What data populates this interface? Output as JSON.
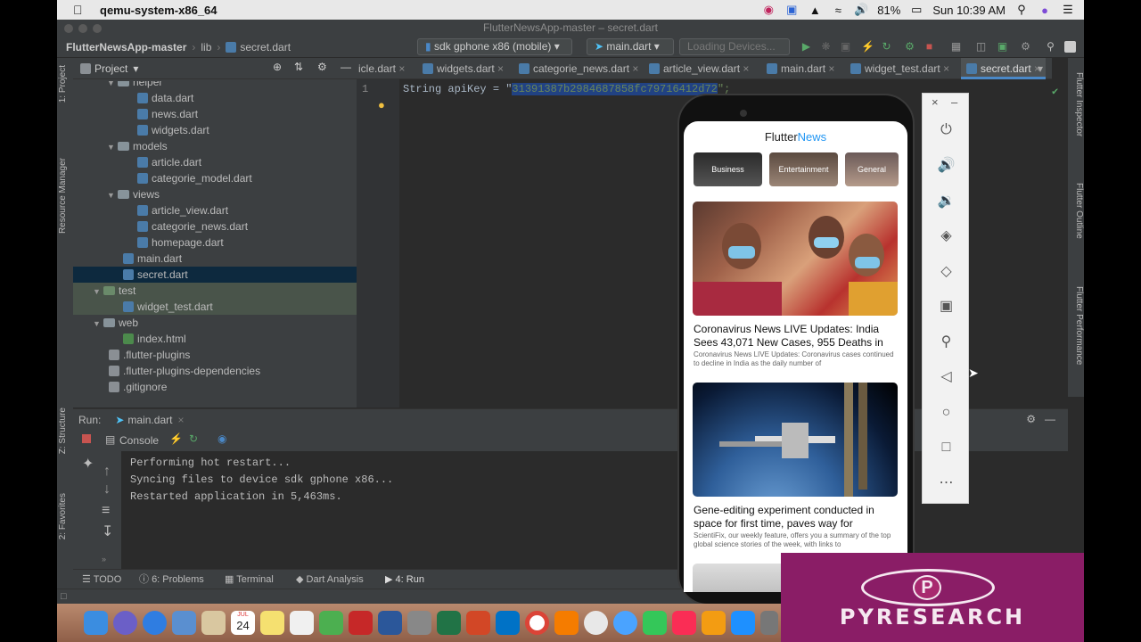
{
  "menubar": {
    "app_name": "qemu-system-x86_64",
    "battery": "81%",
    "clock": "Sun 10:39 AM"
  },
  "window": {
    "title": "FlutterNewsApp-master – secret.dart"
  },
  "navbar": {
    "project": "FlutterNewsApp-master",
    "folder": "lib",
    "file": "secret.dart",
    "device": "sdk gphone x86 (mobile)",
    "run_config": "main.dart",
    "loading": "Loading Devices..."
  },
  "left_tabs": {
    "project": "1: Project",
    "resource_manager": "Resource Manager",
    "structure": "Z: Structure",
    "favorites": "2: Favorites"
  },
  "right_tabs": {
    "inspector": "Flutter Inspector",
    "outline": "Flutter Outline",
    "performance": "Flutter Performance"
  },
  "project_panel": {
    "title": "Project",
    "tree": [
      {
        "label": "helper",
        "type": "dir"
      },
      {
        "label": "data.dart",
        "type": "dart"
      },
      {
        "label": "news.dart",
        "type": "dart"
      },
      {
        "label": "widgets.dart",
        "type": "dart"
      },
      {
        "label": "models",
        "type": "dir"
      },
      {
        "label": "article.dart",
        "type": "dart"
      },
      {
        "label": "categorie_model.dart",
        "type": "dart"
      },
      {
        "label": "views",
        "type": "dir"
      },
      {
        "label": "article_view.dart",
        "type": "dart"
      },
      {
        "label": "categorie_news.dart",
        "type": "dart"
      },
      {
        "label": "homepage.dart",
        "type": "dart"
      },
      {
        "label": "main.dart",
        "type": "dart"
      },
      {
        "label": "secret.dart",
        "type": "dart"
      },
      {
        "label": "test",
        "type": "dir"
      },
      {
        "label": "widget_test.dart",
        "type": "dart"
      },
      {
        "label": "web",
        "type": "dir"
      },
      {
        "label": "index.html",
        "type": "html"
      },
      {
        "label": ".flutter-plugins",
        "type": "txt"
      },
      {
        "label": ".flutter-plugins-dependencies",
        "type": "txt"
      },
      {
        "label": ".gitignore",
        "type": "txt"
      }
    ]
  },
  "editor_tabs": [
    "icle.dart",
    "widgets.dart",
    "categorie_news.dart",
    "article_view.dart",
    "main.dart",
    "widget_test.dart",
    "secret.dart"
  ],
  "editor": {
    "line_number": "1",
    "code_prefix": "String apiKey = \"",
    "code_key": "31391387b2984687858fc79716412d72",
    "code_suffix": "\";"
  },
  "run_panel": {
    "label": "Run:",
    "config": "main.dart",
    "console_tab": "Console",
    "lines": [
      "Performing hot restart...",
      "Syncing files to device sdk gphone x86...",
      "Restarted application in 5,463ms."
    ]
  },
  "bottom_tabs": {
    "todo": "TODO",
    "problems": "6: Problems",
    "terminal": "Terminal",
    "dart_analysis": "Dart Analysis",
    "run": "4: Run"
  },
  "app": {
    "title_a": "Flutter",
    "title_b": "News",
    "categories": [
      "Business",
      "Entertainment",
      "General"
    ],
    "articles": [
      {
        "title": "Coronavirus News LIVE Updates: India Sees 43,071 New Cases, 955 Deaths in",
        "desc": "Coronavirus News LIVE Updates: Coronavirus cases continued to decline in India as the daily number of"
      },
      {
        "title": "Gene-editing experiment conducted in space for first time, paves way for",
        "desc": "ScientiFix, our weekly feature, offers you a summary of the top global science stories of the week, with links to"
      }
    ]
  },
  "banner": {
    "letter": "P",
    "word": "PYRESEARCH"
  },
  "dock": {
    "calendar_month": "JUL",
    "calendar_day": "24"
  },
  "colors": {
    "ide_bg": "#2b2b2b",
    "panel_bg": "#3c3f41",
    "accent_blue": "#2196f3",
    "banner_bg": "#8a1d66"
  }
}
